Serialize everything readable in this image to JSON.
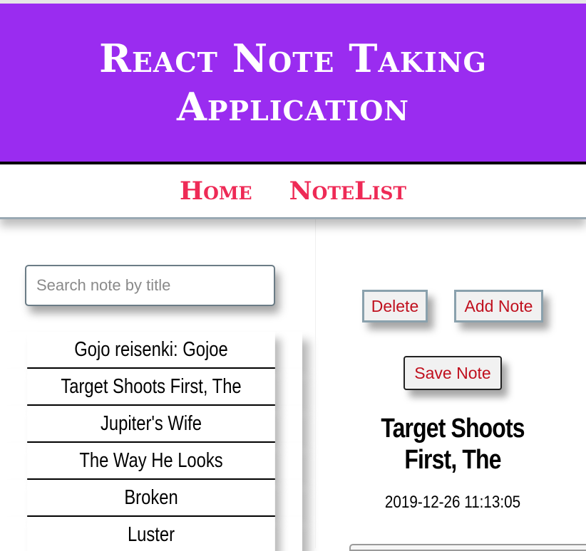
{
  "app": {
    "title": "React Note Taking Application"
  },
  "nav": {
    "items": [
      {
        "label": "Home"
      },
      {
        "label": "NoteList"
      }
    ]
  },
  "search": {
    "placeholder": "Search note by title",
    "value": ""
  },
  "notes": {
    "items": [
      {
        "title": "Gojo reisenki: Gojoe"
      },
      {
        "title": "Target Shoots First, The"
      },
      {
        "title": "Jupiter's Wife"
      },
      {
        "title": "The Way He Looks"
      },
      {
        "title": "Broken"
      },
      {
        "title": "Luster"
      }
    ]
  },
  "actions": {
    "delete_label": "Delete",
    "add_label": "Add Note",
    "save_label": "Save Note"
  },
  "selected_note": {
    "title": "Target Shoots First, The",
    "date": "2019-12-26 11:13:05"
  },
  "colors": {
    "header_bg": "#9a2cf0",
    "nav_link": "#ee2a56",
    "button_text": "#c0101e"
  }
}
